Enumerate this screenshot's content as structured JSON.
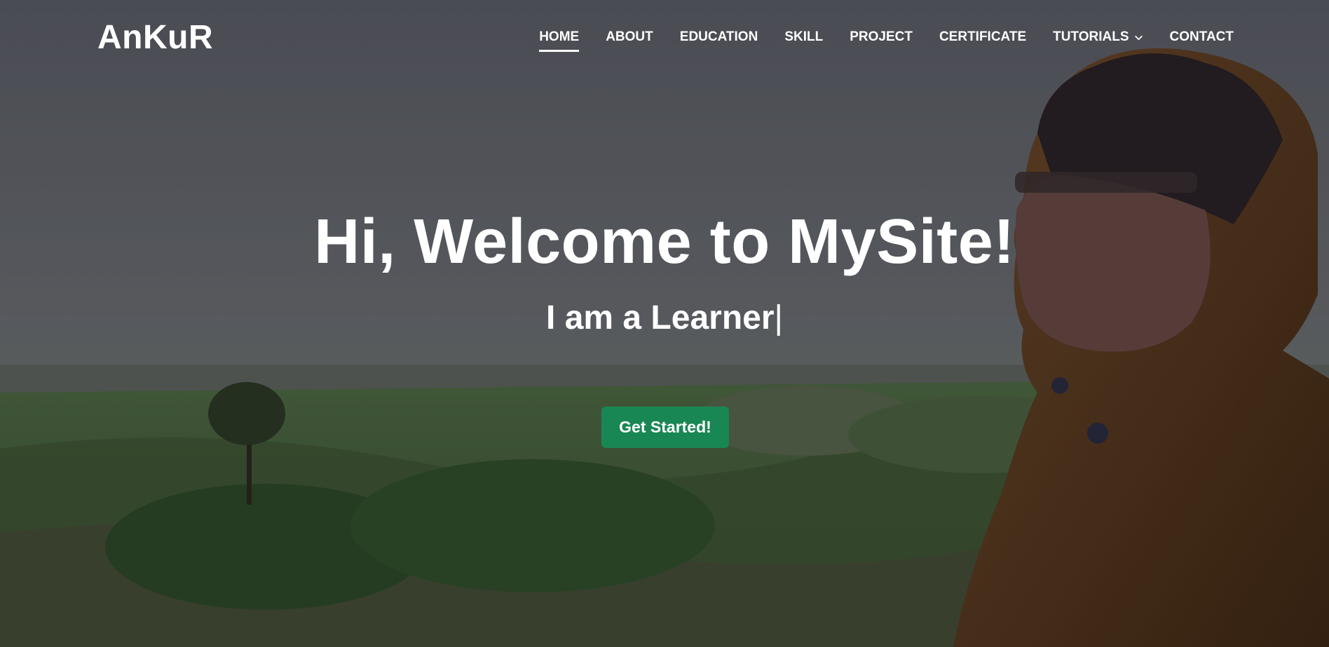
{
  "brand": {
    "logo_text": "AnKuR"
  },
  "nav": {
    "items": [
      {
        "label": "HOME",
        "active": true
      },
      {
        "label": "ABOUT"
      },
      {
        "label": "EDUCATION"
      },
      {
        "label": "SKILL"
      },
      {
        "label": "PROJECT"
      },
      {
        "label": "CERTIFICATE"
      },
      {
        "label": "TUTORIALS",
        "dropdown": true
      },
      {
        "label": "CONTACT"
      }
    ]
  },
  "hero": {
    "title": "Hi, Welcome to MySite!",
    "subtitle": "I am a Learner",
    "cursor": "|",
    "cta_label": "Get Started!",
    "background_image": "portrait-landscape-photo"
  },
  "colors": {
    "cta": "#198754",
    "text": "#ffffff",
    "overlay": "#5f6168"
  }
}
